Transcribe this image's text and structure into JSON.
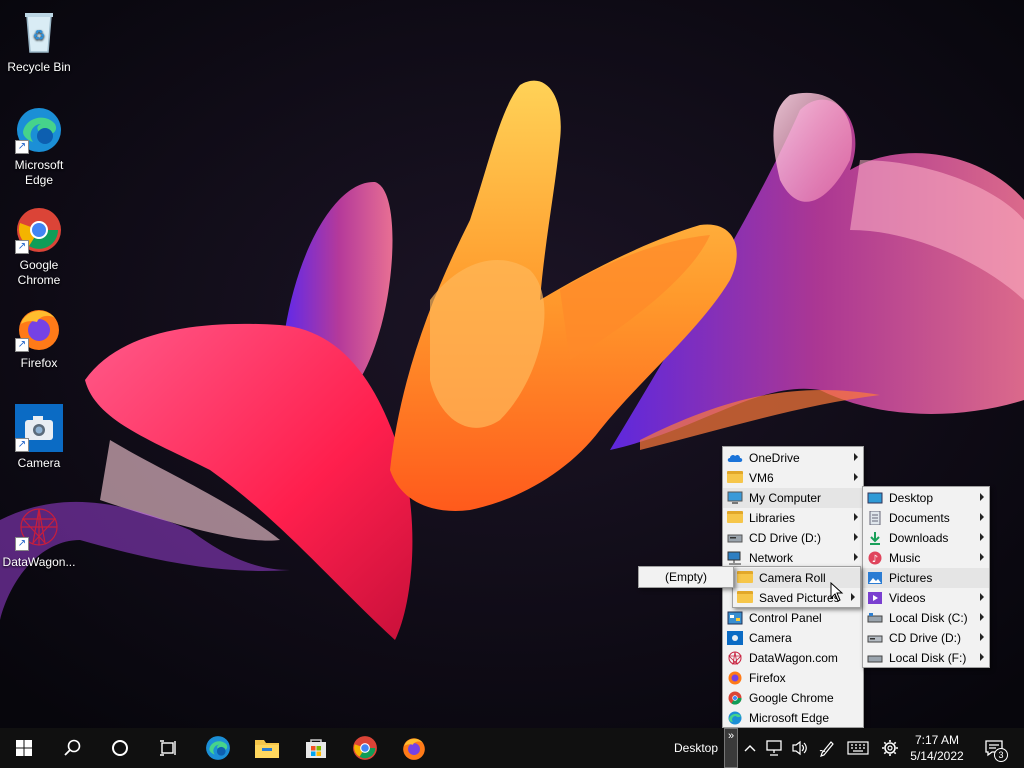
{
  "desktop": {
    "icons": [
      {
        "label": "Recycle Bin",
        "icon": "recycle-bin-icon"
      },
      {
        "label": "Microsoft Edge",
        "icon": "edge-icon"
      },
      {
        "label": "Google Chrome",
        "icon": "chrome-icon"
      },
      {
        "label": "Firefox",
        "icon": "firefox-icon"
      },
      {
        "label": "Camera",
        "icon": "camera-icon"
      },
      {
        "label": "DataWagon...",
        "icon": "datawagon-icon"
      }
    ]
  },
  "menu_main": {
    "items": [
      {
        "label": "OneDrive",
        "icon": "onedrive-icon",
        "submenu": true
      },
      {
        "label": "VM6",
        "icon": "folder-icon",
        "submenu": true
      },
      {
        "label": "My Computer",
        "icon": "computer-icon",
        "submenu": false,
        "highlighted": true
      },
      {
        "label": "Libraries",
        "icon": "libraries-icon",
        "submenu": true
      },
      {
        "label": "CD Drive (D:)",
        "icon": "cd-drive-icon",
        "submenu": true
      },
      {
        "label": "Network",
        "icon": "network-icon",
        "submenu": true
      },
      {
        "label": "Control Panel",
        "icon": "control-panel-icon",
        "submenu": false
      },
      {
        "label": "Camera",
        "icon": "camera-icon",
        "submenu": false
      },
      {
        "label": "DataWagon.com",
        "icon": "datawagon-icon",
        "submenu": false
      },
      {
        "label": "Firefox",
        "icon": "firefox-icon",
        "submenu": false
      },
      {
        "label": "Google Chrome",
        "icon": "chrome-icon",
        "submenu": false
      },
      {
        "label": "Microsoft Edge",
        "icon": "edge-icon",
        "submenu": false
      }
    ]
  },
  "menu_computer": {
    "items": [
      {
        "label": "Desktop",
        "icon": "desktop-icon",
        "submenu": true
      },
      {
        "label": "Documents",
        "icon": "documents-icon",
        "submenu": true
      },
      {
        "label": "Downloads",
        "icon": "downloads-icon",
        "submenu": true
      },
      {
        "label": "Music",
        "icon": "music-icon",
        "submenu": true
      },
      {
        "label": "Pictures",
        "icon": "pictures-icon",
        "submenu": false,
        "highlighted": true
      },
      {
        "label": "Videos",
        "icon": "videos-icon",
        "submenu": true
      },
      {
        "label": "Local Disk (C:)",
        "icon": "local-disk-icon",
        "submenu": true
      },
      {
        "label": "CD Drive (D:)",
        "icon": "cd-drive-icon",
        "submenu": true
      },
      {
        "label": "Local Disk (F:)",
        "icon": "local-disk-icon",
        "submenu": true
      }
    ]
  },
  "menu_pictures": {
    "items": [
      {
        "label": "Camera Roll",
        "icon": "folder-icon",
        "submenu": false,
        "highlighted": true
      },
      {
        "label": "Saved Pictures",
        "icon": "folder-icon",
        "submenu": true
      }
    ]
  },
  "menu_empty": {
    "label": "(Empty)"
  },
  "taskbar": {
    "toolbar_label": "Desktop",
    "expand_label": "»",
    "time": "7:17 AM",
    "date": "5/14/2022",
    "notification_count": "3"
  },
  "colors": {
    "taskbar": "#101010",
    "menu_bg": "#f2f2f2",
    "highlight": "#e5e5e5",
    "accent": "#0078d7"
  }
}
